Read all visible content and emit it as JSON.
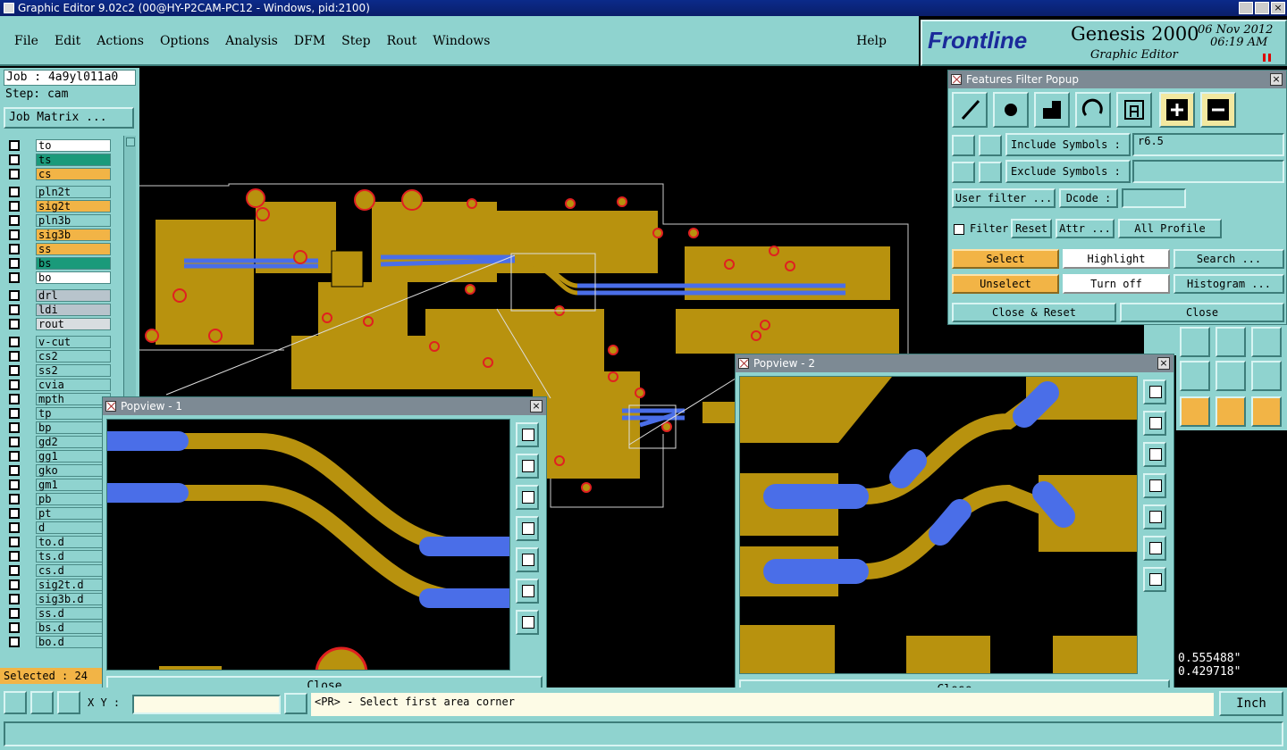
{
  "window": {
    "title": "Graphic Editor 9.02c2 (00@HY-P2CAM-PC12 - Windows, pid:2100)"
  },
  "menu": {
    "items": [
      "File",
      "Edit",
      "Actions",
      "Options",
      "Analysis",
      "DFM",
      "Step",
      "Rout",
      "Windows"
    ],
    "help": "Help"
  },
  "brand": {
    "logo": "Frontline",
    "product": "Genesis 2000",
    "subtitle": "Graphic Editor",
    "date": "06 Nov 2012",
    "time": "06:19 AM"
  },
  "job": {
    "job_label": "Job : 4a9yl011a0",
    "step_label": "Step: cam",
    "matrix_button": "Job Matrix ..."
  },
  "layers": [
    {
      "name": "to",
      "color": "#ffffff"
    },
    {
      "name": "ts",
      "color": "#1a9a7a"
    },
    {
      "name": "cs",
      "color": "#f2b446"
    },
    {
      "name": "pln2t",
      "color": "#8fd3cf"
    },
    {
      "name": "sig2t",
      "color": "#f2b446"
    },
    {
      "name": "pln3b",
      "color": "#8fd3cf"
    },
    {
      "name": "sig3b",
      "color": "#f2b446"
    },
    {
      "name": "ss",
      "color": "#f2b446"
    },
    {
      "name": "bs",
      "color": "#1a9a7a"
    },
    {
      "name": "bo",
      "color": "#ffffff"
    },
    {
      "name": "drl",
      "color": "#b8c4cc"
    },
    {
      "name": "ldi",
      "color": "#b8c4cc"
    },
    {
      "name": "rout",
      "color": "#d8dde0"
    },
    {
      "name": "v-cut",
      "color": "#8fd3cf"
    },
    {
      "name": "cs2",
      "color": "#8fd3cf"
    },
    {
      "name": "ss2",
      "color": "#8fd3cf"
    },
    {
      "name": "cvia",
      "color": "#8fd3cf"
    },
    {
      "name": "mpth",
      "color": "#8fd3cf"
    },
    {
      "name": "tp",
      "color": "#8fd3cf"
    },
    {
      "name": "bp",
      "color": "#8fd3cf"
    },
    {
      "name": "gd2",
      "color": "#8fd3cf"
    },
    {
      "name": "gg1",
      "color": "#8fd3cf"
    },
    {
      "name": "gko",
      "color": "#8fd3cf"
    },
    {
      "name": "gm1",
      "color": "#8fd3cf"
    },
    {
      "name": "pb",
      "color": "#8fd3cf"
    },
    {
      "name": "pt",
      "color": "#8fd3cf"
    },
    {
      "name": "d",
      "color": "#8fd3cf"
    },
    {
      "name": "to.d",
      "color": "#8fd3cf"
    },
    {
      "name": "ts.d",
      "color": "#8fd3cf"
    },
    {
      "name": "cs.d",
      "color": "#8fd3cf"
    },
    {
      "name": "sig2t.d",
      "color": "#8fd3cf"
    },
    {
      "name": "sig3b.d",
      "color": "#8fd3cf"
    },
    {
      "name": "ss.d",
      "color": "#8fd3cf"
    },
    {
      "name": "bs.d",
      "color": "#8fd3cf"
    },
    {
      "name": "bo.d",
      "color": "#8fd3cf"
    }
  ],
  "selected": "Selected : 24",
  "filter": {
    "title": "Features Filter Popup",
    "include_label": "Include Symbols :",
    "include_value": "r6.5",
    "exclude_label": "Exclude Symbols :",
    "exclude_value": "",
    "user_filter": "User filter ...",
    "dcode_label": "Dcode :",
    "filter_label": "Filter",
    "reset": "Reset",
    "attr": "Attr ...",
    "all_profile": "All Profile",
    "select": "Select",
    "highlight": "Highlight",
    "search": "Search ...",
    "unselect": "Unselect",
    "turn_off": "Turn off",
    "histogram": "Histogram ...",
    "close_reset": "Close & Reset",
    "close": "Close"
  },
  "popview1": {
    "title": "Popview - 1",
    "close": "Close"
  },
  "popview2": {
    "title": "Popview - 2",
    "close": "Close"
  },
  "status": {
    "xy_label": "X Y :",
    "prompt": "<PR> - Select first area corner",
    "units": "Inch",
    "coord_x": "0.555488\"",
    "coord_y": "0.429718\""
  },
  "colors": {
    "copper": "#b8920e",
    "trace": "#4a6ee8",
    "pad_outline": "#e02020",
    "panel": "#8fd3cf",
    "background": "#000000"
  }
}
